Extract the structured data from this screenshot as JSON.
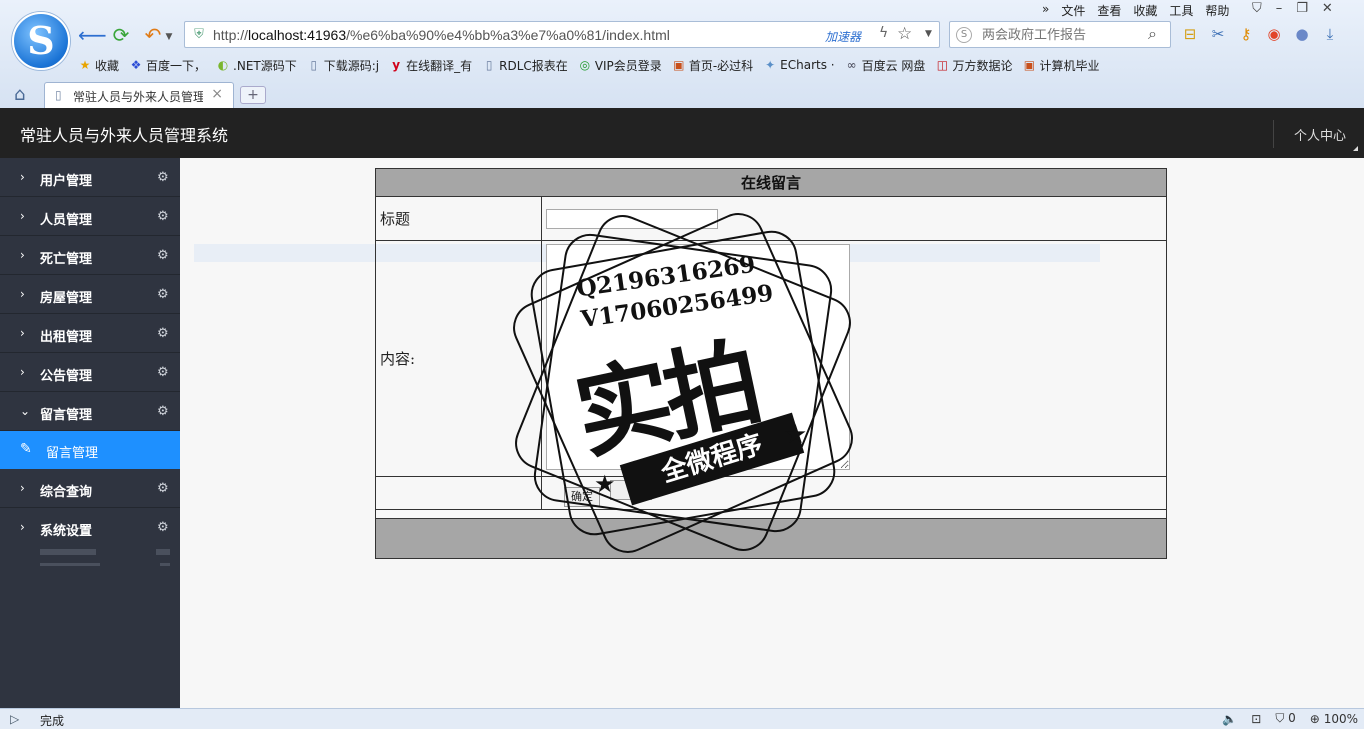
{
  "browser": {
    "menu": [
      "文件",
      "查看",
      "收藏",
      "工具",
      "帮助"
    ],
    "address": {
      "url_prefix": "http://",
      "url_host": "localhost:41963",
      "url_path": "/%e6%ba%90%e4%bb%a3%e7%a0%81/index.html",
      "accelerator": "加速器"
    },
    "search": {
      "placeholder": "两会政府工作报告"
    },
    "bookmarks": [
      {
        "label": "收藏",
        "icon": "star-icon"
      },
      {
        "label": "百度一下，",
        "icon": "baidu-icon"
      },
      {
        "label": ".NET源码下",
        "icon": "net-icon"
      },
      {
        "label": "下载源码:j",
        "icon": "page-icon"
      },
      {
        "label": "在线翻译_有",
        "icon": "youdao-icon"
      },
      {
        "label": "RDLC报表在",
        "icon": "page-icon"
      },
      {
        "label": "VIP会员登录",
        "icon": "vip-icon"
      },
      {
        "label": "首页-必过科",
        "icon": "site-icon"
      },
      {
        "label": "ECharts ·",
        "icon": "echarts-icon"
      },
      {
        "label": "百度云 网盘",
        "icon": "cloud-icon"
      },
      {
        "label": "万方数据论",
        "icon": "wanfang-icon"
      },
      {
        "label": "计算机毕业",
        "icon": "site-icon"
      }
    ],
    "tab": {
      "label": "常驻人员与外来人员管理"
    },
    "status": {
      "text": "完成",
      "count": "0",
      "zoom": "100%"
    }
  },
  "app": {
    "title": "常驻人员与外来人员管理系统",
    "user_center": "个人中心",
    "sidebar": [
      "用户管理",
      "人员管理",
      "死亡管理",
      "房屋管理",
      "出租管理",
      "公告管理",
      "留言管理"
    ],
    "sidebar_active_sub": "留言管理",
    "sidebar_after": [
      "综合查询",
      "系统设置"
    ]
  },
  "form": {
    "heading": "在线留言",
    "title_label": "标题",
    "content_label": "内容:",
    "submit": "确定",
    "reset": ""
  },
  "stamp": {
    "line1": "Q2196316269",
    "line2": "V17060256499",
    "big": "实拍",
    "banner": "全微程序"
  },
  "colors": {
    "header_bg": "#222222",
    "sidebar_bg": "#2f3440",
    "active_item": "#1e90ff",
    "table_header": "#a6a6a6"
  }
}
